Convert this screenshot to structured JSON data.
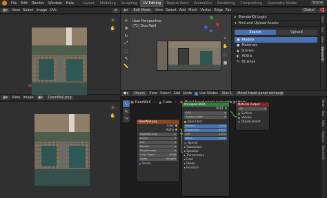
{
  "topbar": {
    "menus": [
      "File",
      "Edit",
      "Render",
      "Window",
      "Help"
    ],
    "workspaces": [
      "Layout",
      "Modeling",
      "Sculpting",
      "UV Editing",
      "Texture Paint",
      "Animation",
      "Rendering",
      "Compositing",
      "Geometry Nodes"
    ],
    "active_workspace": "UV Editing",
    "scene_label": "Scene"
  },
  "uv_editor": {
    "header": {
      "view": "View",
      "select": "Select",
      "image": "Image",
      "uvs": "UVs"
    }
  },
  "image_editor": {
    "header": {
      "view": "View",
      "image": "Image",
      "image_name": "DoorWall.png"
    }
  },
  "viewport": {
    "header": {
      "mode": "Edit Mode",
      "view": "View",
      "select": "Select",
      "add": "Add",
      "mesh": "Mesh",
      "vertex": "Vertex",
      "edge": "Edge",
      "face": "Face",
      "uv": "UV",
      "orientation": "Global"
    },
    "overlay_title": "User Perspective",
    "overlay_object": "(71) DoorWall"
  },
  "asset_panel": {
    "login": "BlenderKit Login",
    "find_upload": "Find and Upload Assets",
    "search_tab": "Search",
    "upload_tab": "Upload",
    "categories": [
      "Models",
      "Materials",
      "Scenes",
      "HDRIs",
      "Brushes"
    ],
    "active_category": "Models",
    "side_tabs": [
      "Item",
      "Tool",
      "View",
      "BlenderKit"
    ]
  },
  "node_editor": {
    "header": {
      "type": "Object",
      "view": "View",
      "select": "Select",
      "add": "Add",
      "node": "Node",
      "use_nodes": "Use Nodes",
      "slot": "Slot 1",
      "material": "Metal tread panel rectangle pat"
    },
    "breadcrumb": [
      "DoorWall",
      "Cube",
      "Metal tread panel rectangle pattern"
    ],
    "side_tabs": [
      "Node",
      "Tool",
      "View",
      "Options",
      "BlenderKit"
    ],
    "image_node": {
      "title": "DoorWall.png",
      "outputs": [
        "Color",
        "Alpha"
      ],
      "image_name": "DoorWall.png",
      "fields": [
        {
          "label": "Linear",
          "value": ""
        },
        {
          "label": "Flat",
          "value": ""
        },
        {
          "label": "Repeat",
          "value": ""
        },
        {
          "label": "Single Image",
          "value": ""
        },
        {
          "label": "Color Space",
          "value": "sRGB"
        },
        {
          "label": "Alpha",
          "value": "Straight"
        }
      ],
      "vector_label": "Vector"
    },
    "bsdf_node": {
      "title": "Principled BSDF",
      "output": "BSDF",
      "dropdowns": [
        "GGX",
        "Random Walk"
      ],
      "inputs": [
        {
          "label": "Base Color",
          "value": ""
        },
        {
          "label": "Metallic",
          "value": "0.000"
        },
        {
          "label": "Roughness",
          "value": "0.500"
        },
        {
          "label": "IOR",
          "value": "1.450"
        },
        {
          "label": "Alpha",
          "value": "1.000"
        },
        {
          "label": "Normal",
          "value": ""
        },
        {
          "label": "Subsurface",
          "value": ""
        },
        {
          "label": "Specular",
          "value": ""
        },
        {
          "label": "Transmission",
          "value": ""
        },
        {
          "label": "Coat",
          "value": ""
        },
        {
          "label": "Sheen",
          "value": ""
        },
        {
          "label": "Emission",
          "value": ""
        }
      ]
    },
    "output_node": {
      "title": "Material Output",
      "target": "All",
      "inputs": [
        "Surface",
        "Volume",
        "Displacement"
      ]
    }
  },
  "colors": {
    "accent": "#4772b3",
    "blender_orange": "#e87d0d",
    "image_node_header": "#8b4524",
    "bsdf_node_header": "#3b7a3e",
    "output_node_header": "#7a2a2a"
  }
}
